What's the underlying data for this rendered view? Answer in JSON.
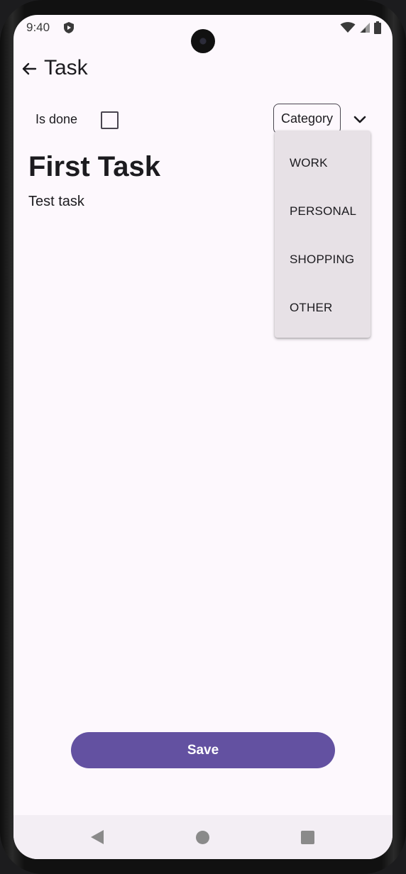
{
  "status_bar": {
    "time": "9:40",
    "icons": [
      "shield-icon",
      "wifi-icon",
      "signal-icon",
      "battery-icon"
    ]
  },
  "app_bar": {
    "back_icon": "arrow-left-icon",
    "title": "Task"
  },
  "form": {
    "is_done_label": "Is done",
    "is_done_checked": false,
    "category_label": "Category",
    "category_icon": "chevron-down-icon"
  },
  "task": {
    "title": "First Task",
    "description": "Test task"
  },
  "category_menu": {
    "items": [
      "WORK",
      "PERSONAL",
      "SHOPPING",
      "OTHER"
    ]
  },
  "actions": {
    "save_label": "Save"
  },
  "nav": {
    "icons": [
      "back-triangle-icon",
      "home-circle-icon",
      "recents-square-icon"
    ]
  },
  "colors": {
    "primary": "#6351a1",
    "surface": "#fdf8fd",
    "menu_surface": "#e7e1e6",
    "text": "#1c1b1f"
  }
}
